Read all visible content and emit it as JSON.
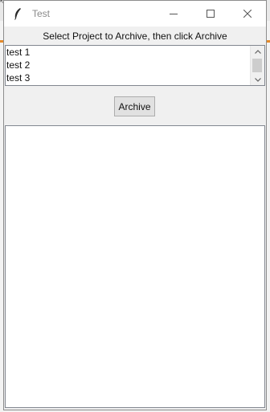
{
  "window": {
    "title": "Test",
    "icon": "feather-icon",
    "controls": {
      "minimize_icon": "minimize-icon",
      "maximize_icon": "maximize-icon",
      "close_icon": "close-icon"
    }
  },
  "instruction": "Select Project to Archive, then click Archive",
  "projects": {
    "items": [
      "test 1",
      "test 2",
      "test 3"
    ]
  },
  "archive_button": {
    "label": "Archive"
  },
  "colors": {
    "background_accent": "#e58b2b",
    "window_bg": "#f0f0f0",
    "field_bg": "#ffffff"
  }
}
